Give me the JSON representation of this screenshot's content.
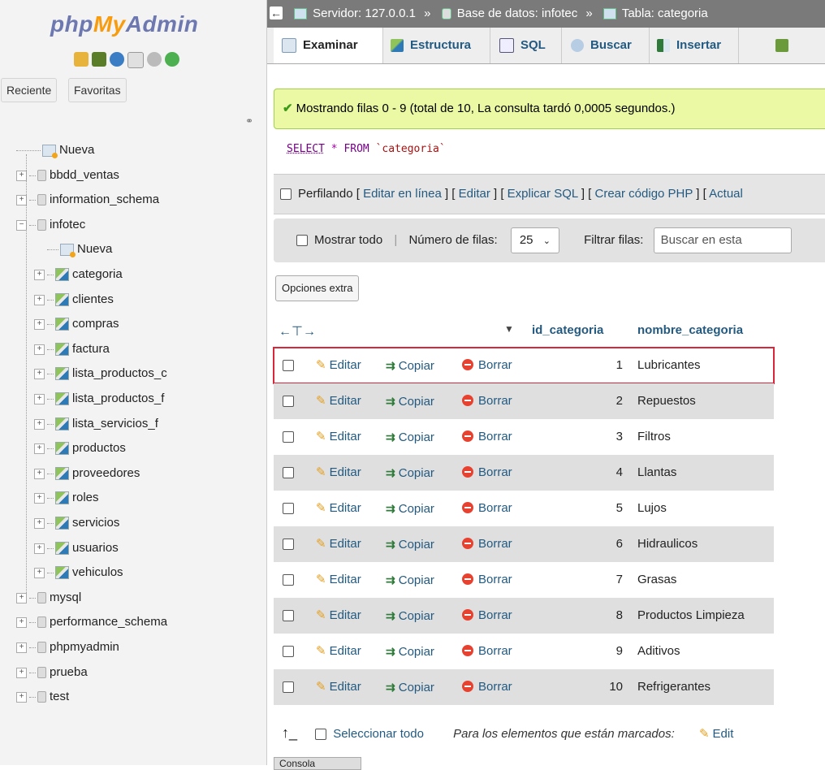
{
  "sidebar": {
    "logo_php": "php",
    "logo_my": "My",
    "logo_admin": "Admin",
    "recent_tab": "Reciente",
    "favorites_tab": "Favoritas",
    "tree": [
      {
        "label": "Nueva",
        "level": 0,
        "type": "new"
      },
      {
        "label": "bbdd_ventas",
        "level": 0,
        "type": "db"
      },
      {
        "label": "information_schema",
        "level": 0,
        "type": "db"
      },
      {
        "label": "infotec",
        "level": 0,
        "type": "db-open"
      },
      {
        "label": "Nueva",
        "level": 1,
        "type": "new"
      },
      {
        "label": "categoria",
        "level": 1,
        "type": "table",
        "selected": true
      },
      {
        "label": "clientes",
        "level": 1,
        "type": "table"
      },
      {
        "label": "compras",
        "level": 1,
        "type": "table"
      },
      {
        "label": "factura",
        "level": 1,
        "type": "table"
      },
      {
        "label": "lista_productos_c",
        "level": 1,
        "type": "table"
      },
      {
        "label": "lista_productos_f",
        "level": 1,
        "type": "table"
      },
      {
        "label": "lista_servicios_f",
        "level": 1,
        "type": "table"
      },
      {
        "label": "productos",
        "level": 1,
        "type": "table"
      },
      {
        "label": "proveedores",
        "level": 1,
        "type": "table"
      },
      {
        "label": "roles",
        "level": 1,
        "type": "table"
      },
      {
        "label": "servicios",
        "level": 1,
        "type": "table"
      },
      {
        "label": "usuarios",
        "level": 1,
        "type": "table"
      },
      {
        "label": "vehiculos",
        "level": 1,
        "type": "table"
      },
      {
        "label": "mysql",
        "level": 0,
        "type": "db"
      },
      {
        "label": "performance_schema",
        "level": 0,
        "type": "db"
      },
      {
        "label": "phpmyadmin",
        "level": 0,
        "type": "db"
      },
      {
        "label": "prueba",
        "level": 0,
        "type": "db"
      },
      {
        "label": "test",
        "level": 0,
        "type": "db"
      }
    ]
  },
  "breadcrumb": {
    "server": "Servidor: 127.0.0.1",
    "database": "Base de datos: infotec",
    "table": "Tabla: categoria",
    "separator": "»"
  },
  "tabs": [
    {
      "label": "Examinar",
      "active": true
    },
    {
      "label": "Estructura"
    },
    {
      "label": "SQL"
    },
    {
      "label": "Buscar"
    },
    {
      "label": "Insertar"
    }
  ],
  "message": "Mostrando filas 0 - 9 (total de 10, La consulta tardó 0,0005 segundos.)",
  "query": {
    "select": "SELECT",
    "star": "*",
    "from": "FROM",
    "table": "`categoria`"
  },
  "profiling": {
    "label": "Perfilando",
    "links": [
      "Editar en línea",
      "Editar",
      "Explicar SQL",
      "Crear código PHP",
      "Actual"
    ]
  },
  "navigation": {
    "show_all": "Mostrar todo",
    "rows_label": "Número de filas:",
    "rows_value": "25",
    "filter_label": "Filtrar filas:",
    "filter_placeholder": "Buscar en esta"
  },
  "extra_options": "Opciones extra",
  "table": {
    "columns": [
      "id_categoria",
      "nombre_categoria"
    ],
    "actions": {
      "edit": "Editar",
      "copy": "Copiar",
      "delete": "Borrar"
    },
    "rows": [
      {
        "id": "1",
        "name": "Lubricantes"
      },
      {
        "id": "2",
        "name": "Repuestos"
      },
      {
        "id": "3",
        "name": "Filtros"
      },
      {
        "id": "4",
        "name": "Llantas"
      },
      {
        "id": "5",
        "name": "Lujos"
      },
      {
        "id": "6",
        "name": "Hidraulicos"
      },
      {
        "id": "7",
        "name": "Grasas"
      },
      {
        "id": "8",
        "name": "Productos Limpieza"
      },
      {
        "id": "9",
        "name": "Aditivos"
      },
      {
        "id": "10",
        "name": "Refrigerantes"
      }
    ]
  },
  "bottom": {
    "select_all": "Seleccionar todo",
    "with_selected": "Para los elementos que están marcados:",
    "edit": "Edit"
  },
  "console": "Consola",
  "colors": {
    "accent_link": "#235a81",
    "success_bg": "#ebf8a4",
    "highlight_border": "#d9263a"
  }
}
